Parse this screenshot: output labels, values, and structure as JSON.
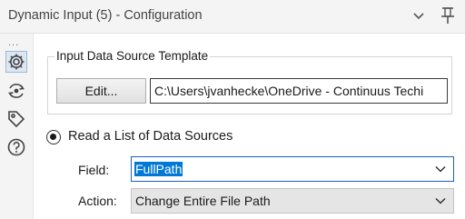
{
  "header": {
    "title": "Dynamic Input (5) - Configuration",
    "collapse_icon": "chevron-down-icon",
    "pin_icon": "pin-icon"
  },
  "sidebar": {
    "overflow": "...",
    "items": [
      {
        "icon": "gear-icon",
        "active": true
      },
      {
        "icon": "connection-icon",
        "active": false
      },
      {
        "icon": "tag-icon",
        "active": false
      },
      {
        "icon": "help-icon",
        "active": false
      }
    ]
  },
  "input_template": {
    "legend": "Input Data Source Template",
    "edit_label": "Edit...",
    "path": "C:\\Users\\jvanhecke\\OneDrive - Continuus Techi"
  },
  "mode": {
    "label": "Read a List of Data Sources",
    "selected": true
  },
  "field": {
    "label": "Field:",
    "value": "FullPath"
  },
  "action": {
    "label": "Action:",
    "value": "Change Entire File Path"
  },
  "colors": {
    "accent": "#0078d7",
    "panel_bg": "#f4f4f4"
  }
}
